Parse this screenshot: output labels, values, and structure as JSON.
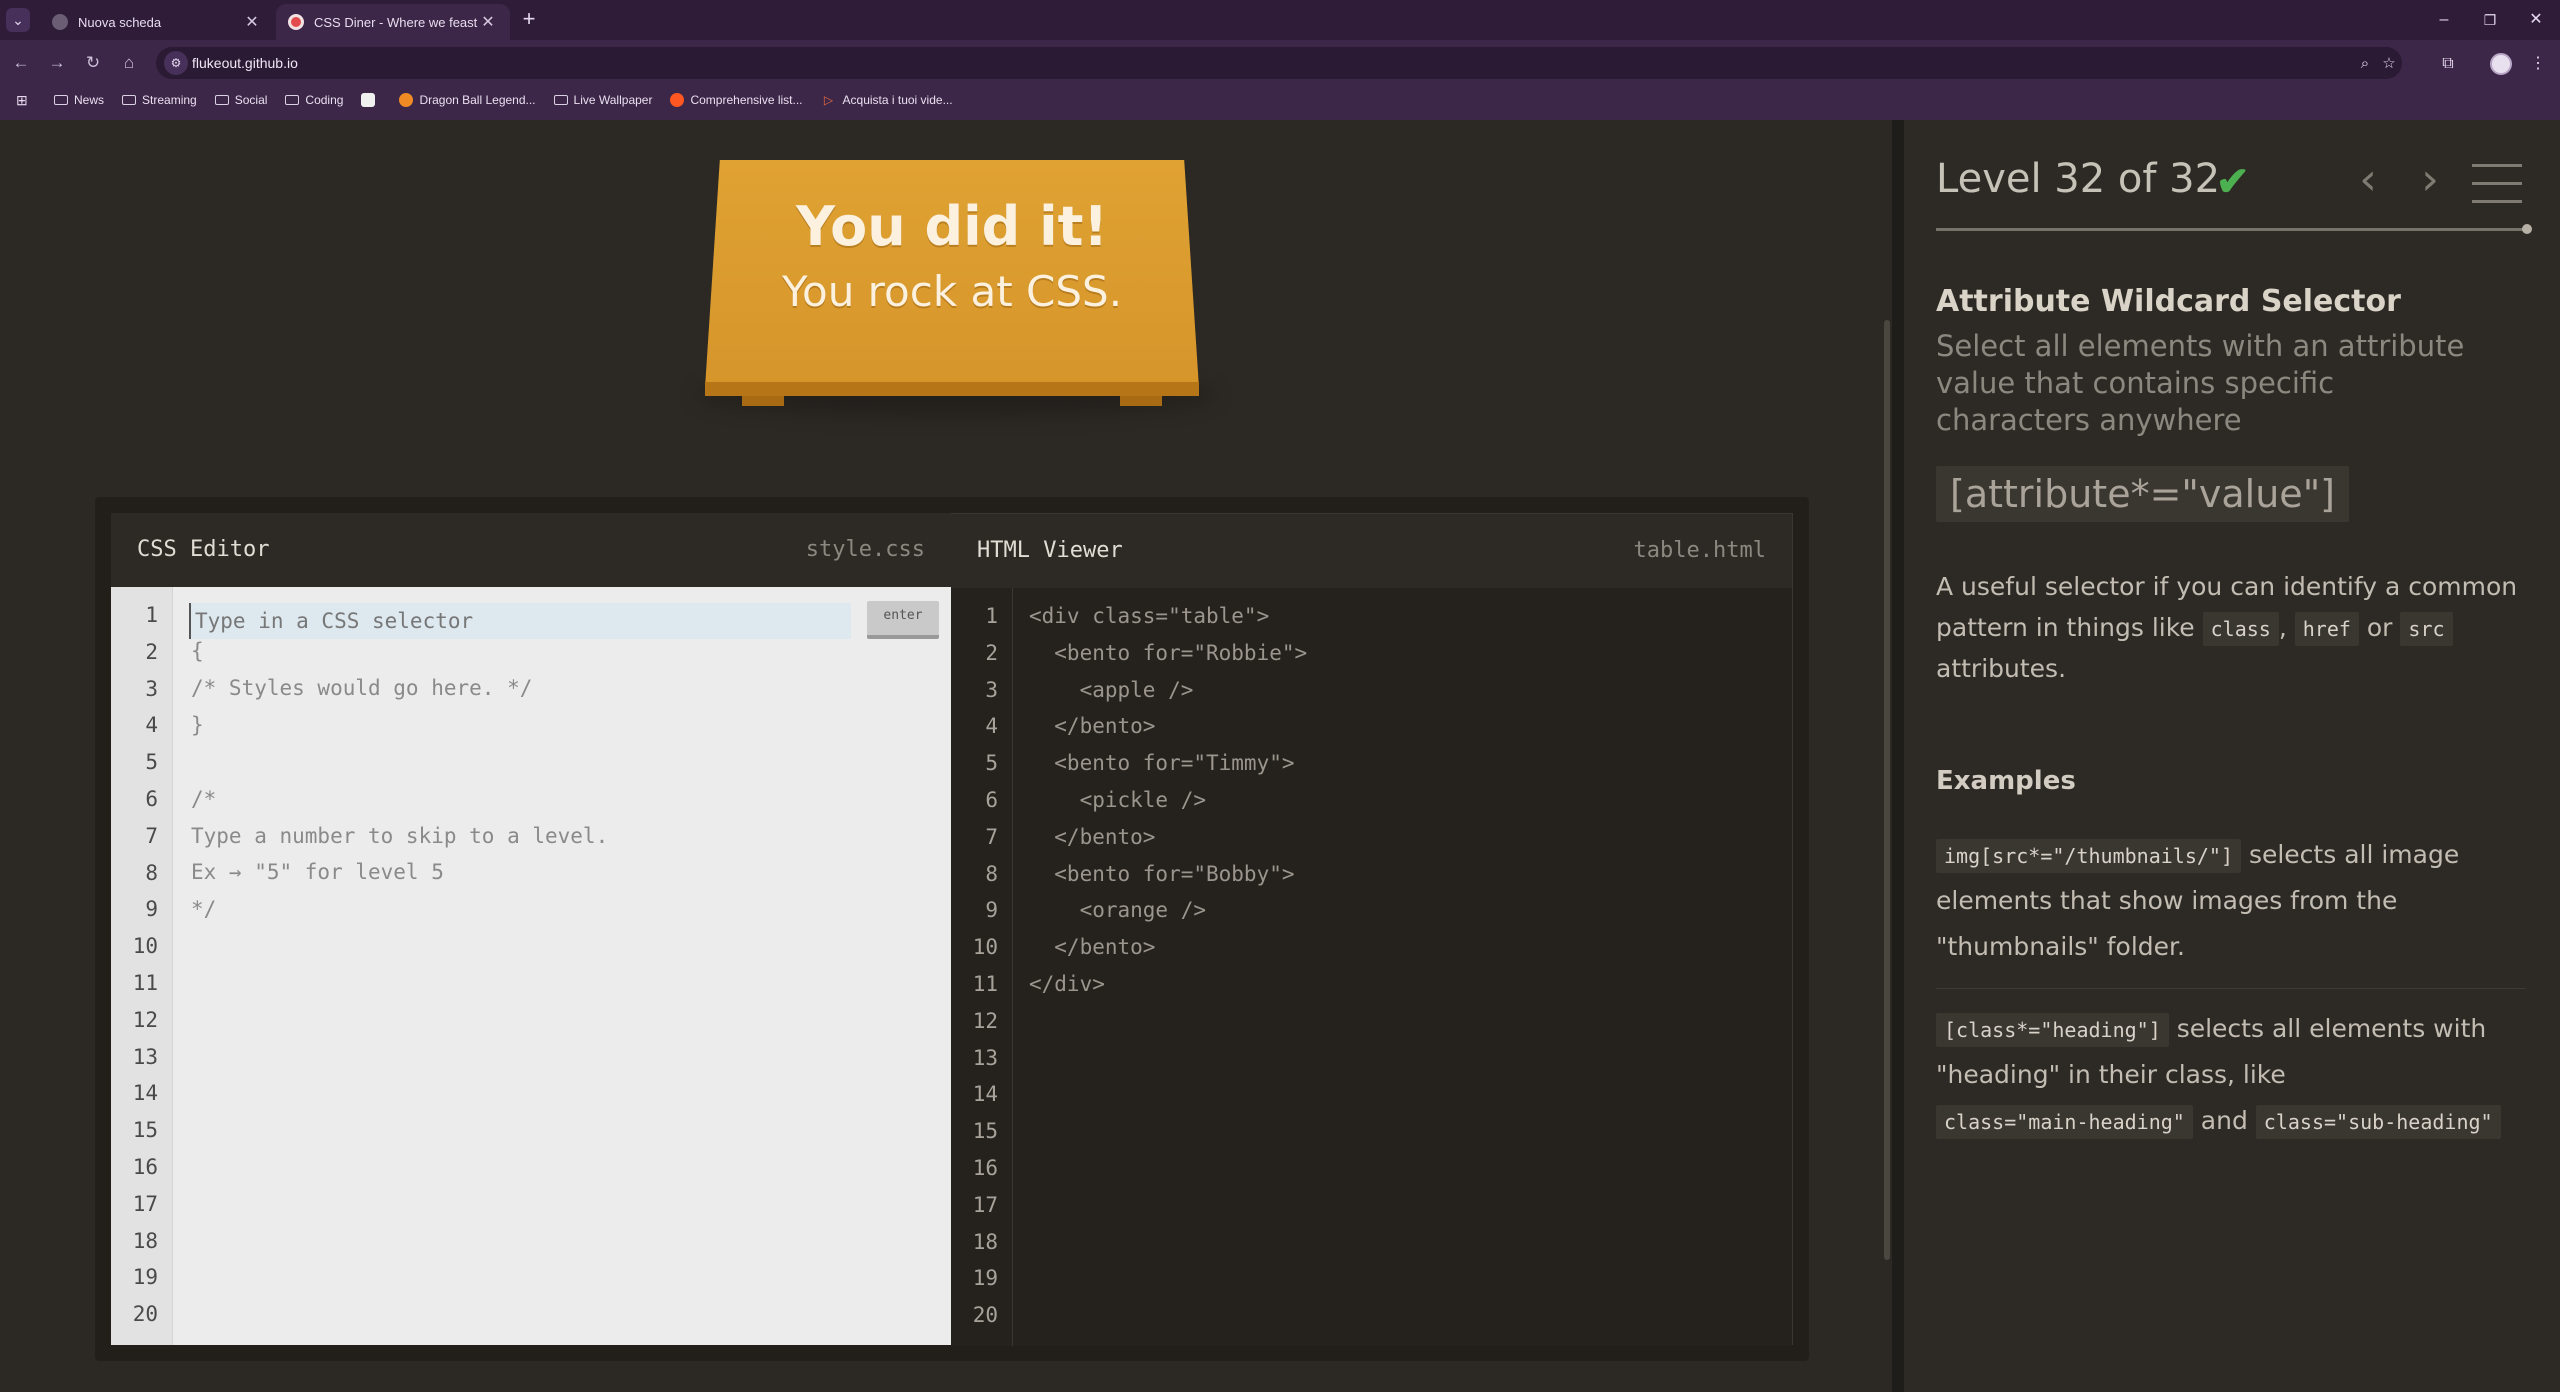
{
  "browser": {
    "tabs": [
      {
        "title": "Nuova scheda",
        "active": false
      },
      {
        "title": "CSS Diner - Where we feast on",
        "active": true
      }
    ],
    "url": "flukeout.github.io",
    "bookmarks": [
      {
        "label": "News",
        "icon": "folder-icon"
      },
      {
        "label": "Streaming",
        "icon": "folder-icon"
      },
      {
        "label": "Social",
        "icon": "folder-icon"
      },
      {
        "label": "Coding",
        "icon": "folder-icon"
      },
      {
        "label": "",
        "icon": "app-icon"
      },
      {
        "label": "Dragon Ball Legend...",
        "icon": "site-icon"
      },
      {
        "label": "Live Wallpaper",
        "icon": "folder-icon"
      },
      {
        "label": "Comprehensive list...",
        "icon": "site-icon"
      },
      {
        "label": "Acquista i tuoi vide...",
        "icon": "site-icon"
      }
    ]
  },
  "banner": {
    "line1": "You did it!",
    "line2": "You rock at CSS."
  },
  "css_editor": {
    "title": "CSS Editor",
    "file": "style.css",
    "placeholder": "Type in a CSS selector",
    "enter_label": "enter",
    "lines": [
      "",
      "{",
      "/* Styles would go here. */",
      "}",
      "",
      "/*",
      "Type a number to skip to a level.",
      "Ex → \"5\" for level 5",
      "*/"
    ],
    "line_count": 20
  },
  "html_viewer": {
    "title": "HTML Viewer",
    "file": "table.html",
    "lines": [
      "<div class=\"table\">",
      "  <bento for=\"Robbie\">",
      "    <apple />",
      "  </bento>",
      "  <bento for=\"Timmy\">",
      "    <pickle />",
      "  </bento>",
      "  <bento for=\"Bobby\">",
      "    <orange />",
      "  </bento>",
      "</div>"
    ],
    "line_count": 20
  },
  "sidebar": {
    "level_text": "Level 32 of 32",
    "selector_name": "Attribute Wildcard Selector",
    "selector_title": "Select all elements with an attribute value that contains specific characters anywhere",
    "syntax": "[attribute*=\"value\"]",
    "hint_pre": "A useful selector if you can identify a common pattern in things like",
    "hint_chip1": "class",
    "hint_sep1": ",",
    "hint_chip2": "href",
    "hint_or": "or",
    "hint_chip3": "src",
    "hint_post": "attributes.",
    "examples_heading": "Examples",
    "example1_code": "img[src*=\"/thumbnails/\"]",
    "example1_text": "selects all image elements that show images from the \"thumbnails\" folder.",
    "example2_code": "[class*=\"heading\"]",
    "example2_text1": "selects all elements with \"heading\" in their class, like",
    "example2_code2": "class=\"main-heading\"",
    "example2_and": "and",
    "example2_code3": "class=\"sub-heading\""
  },
  "colors": {
    "chrome_purple": "#3c2748",
    "page_bg": "#2d2a25",
    "table_orange": "#e0a233",
    "check_green": "#4caf50"
  }
}
